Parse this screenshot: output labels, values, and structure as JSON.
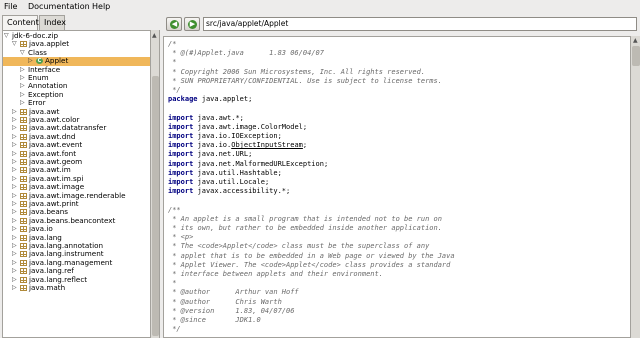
{
  "menubar": {
    "file": "File",
    "documentation": "Documentation",
    "help": "Help"
  },
  "tabs": {
    "content": "Content",
    "index": "Index"
  },
  "navigation": {
    "address": "src/java/applet/Applet"
  },
  "tree": {
    "root": "jdk-6-doc.zip",
    "rows": [
      {
        "label": "jdk-6-doc.zip",
        "indent": 0,
        "arrow": "▽",
        "icon": "none"
      },
      {
        "label": "java.applet",
        "indent": 1,
        "arrow": "▽",
        "icon": "package"
      },
      {
        "label": "Class",
        "indent": 2,
        "arrow": "▽",
        "icon": "none"
      },
      {
        "label": "Applet",
        "indent": 3,
        "arrow": "▷",
        "icon": "class",
        "selected": true
      },
      {
        "label": "Interface",
        "indent": 2,
        "arrow": "▷",
        "icon": "none"
      },
      {
        "label": "Enum",
        "indent": 2,
        "arrow": "▷",
        "icon": "none"
      },
      {
        "label": "Annotation",
        "indent": 2,
        "arrow": "▷",
        "icon": "none"
      },
      {
        "label": "Exception",
        "indent": 2,
        "arrow": "▷",
        "icon": "none"
      },
      {
        "label": "Error",
        "indent": 2,
        "arrow": "▷",
        "icon": "none"
      },
      {
        "label": "java.awt",
        "indent": 1,
        "arrow": "▷",
        "icon": "package"
      },
      {
        "label": "java.awt.color",
        "indent": 1,
        "arrow": "▷",
        "icon": "package"
      },
      {
        "label": "java.awt.datatransfer",
        "indent": 1,
        "arrow": "▷",
        "icon": "package"
      },
      {
        "label": "java.awt.dnd",
        "indent": 1,
        "arrow": "▷",
        "icon": "package"
      },
      {
        "label": "java.awt.event",
        "indent": 1,
        "arrow": "▷",
        "icon": "package"
      },
      {
        "label": "java.awt.font",
        "indent": 1,
        "arrow": "▷",
        "icon": "package"
      },
      {
        "label": "java.awt.geom",
        "indent": 1,
        "arrow": "▷",
        "icon": "package"
      },
      {
        "label": "java.awt.im",
        "indent": 1,
        "arrow": "▷",
        "icon": "package"
      },
      {
        "label": "java.awt.im.spi",
        "indent": 1,
        "arrow": "▷",
        "icon": "package"
      },
      {
        "label": "java.awt.image",
        "indent": 1,
        "arrow": "▷",
        "icon": "package"
      },
      {
        "label": "java.awt.image.renderable",
        "indent": 1,
        "arrow": "▷",
        "icon": "package"
      },
      {
        "label": "java.awt.print",
        "indent": 1,
        "arrow": "▷",
        "icon": "package"
      },
      {
        "label": "java.beans",
        "indent": 1,
        "arrow": "▷",
        "icon": "package"
      },
      {
        "label": "java.beans.beancontext",
        "indent": 1,
        "arrow": "▷",
        "icon": "package"
      },
      {
        "label": "java.io",
        "indent": 1,
        "arrow": "▷",
        "icon": "package"
      },
      {
        "label": "java.lang",
        "indent": 1,
        "arrow": "▷",
        "icon": "package"
      },
      {
        "label": "java.lang.annotation",
        "indent": 1,
        "arrow": "▷",
        "icon": "package"
      },
      {
        "label": "java.lang.instrument",
        "indent": 1,
        "arrow": "▷",
        "icon": "package"
      },
      {
        "label": "java.lang.management",
        "indent": 1,
        "arrow": "▷",
        "icon": "package"
      },
      {
        "label": "java.lang.ref",
        "indent": 1,
        "arrow": "▷",
        "icon": "package"
      },
      {
        "label": "java.lang.reflect",
        "indent": 1,
        "arrow": "▷",
        "icon": "package"
      },
      {
        "label": "java.math",
        "indent": 1,
        "arrow": "▷",
        "icon": "package"
      }
    ]
  },
  "code": {
    "lines": [
      {
        "t": "cm",
        "text": "/*"
      },
      {
        "t": "cm",
        "text": " * @(#)Applet.java      1.83 06/04/07"
      },
      {
        "t": "cm",
        "text": " *"
      },
      {
        "t": "cm",
        "text": " * Copyright 2006 Sun Microsystems, Inc. All rights reserved."
      },
      {
        "t": "cm",
        "text": " * SUN PROPRIETARY/CONFIDENTIAL. Use is subject to license terms."
      },
      {
        "t": "cm",
        "text": " */"
      },
      {
        "t": "kw",
        "kw": "package",
        "text": " java.applet;"
      },
      {
        "t": "blank",
        "text": ""
      },
      {
        "t": "kw",
        "kw": "import",
        "text": " java.awt.*;"
      },
      {
        "t": "kw",
        "kw": "import",
        "text": " java.awt.image.ColorModel;"
      },
      {
        "t": "kw",
        "kw": "import",
        "text": " java.io.IOException;"
      },
      {
        "t": "kw",
        "kw": "import",
        "text": " java.io.ObjectInputStream;",
        "underline": "ObjectInputStream"
      },
      {
        "t": "kw",
        "kw": "import",
        "text": " java.net.URL;"
      },
      {
        "t": "kw",
        "kw": "import",
        "text": " java.net.MalformedURLException;"
      },
      {
        "t": "kw",
        "kw": "import",
        "text": " java.util.Hashtable;"
      },
      {
        "t": "kw",
        "kw": "import",
        "text": " java.util.Locale;"
      },
      {
        "t": "kw",
        "kw": "import",
        "text": " javax.accessibility.*;"
      },
      {
        "t": "blank",
        "text": ""
      },
      {
        "t": "cm",
        "text": "/**"
      },
      {
        "t": "cm",
        "text": " * An applet is a small program that is intended not to be run on"
      },
      {
        "t": "cm",
        "text": " * its own, but rather to be embedded inside another application."
      },
      {
        "t": "cm",
        "text": " * <p>"
      },
      {
        "t": "cm",
        "text": " * The <code>Applet</code> class must be the superclass of any"
      },
      {
        "t": "cm",
        "text": " * applet that is to be embedded in a Web page or viewed by the Java"
      },
      {
        "t": "cm",
        "text": " * Applet Viewer. The <code>Applet</code> class provides a standard"
      },
      {
        "t": "cm",
        "text": " * interface between applets and their environment."
      },
      {
        "t": "cm",
        "text": " *"
      },
      {
        "t": "cm",
        "text": " * @author      Arthur van Hoff"
      },
      {
        "t": "cm",
        "text": " * @author      Chris Warth"
      },
      {
        "t": "cm",
        "text": " * @version     1.83, 04/07/06"
      },
      {
        "t": "cm",
        "text": " * @since       JDK1.0"
      },
      {
        "t": "cm",
        "text": " */"
      }
    ]
  },
  "colors": {
    "selection": "#f0b75a",
    "keyword": "#000080",
    "comment": "#6a6a6a",
    "nav_arrow": "#3f8f2f"
  }
}
